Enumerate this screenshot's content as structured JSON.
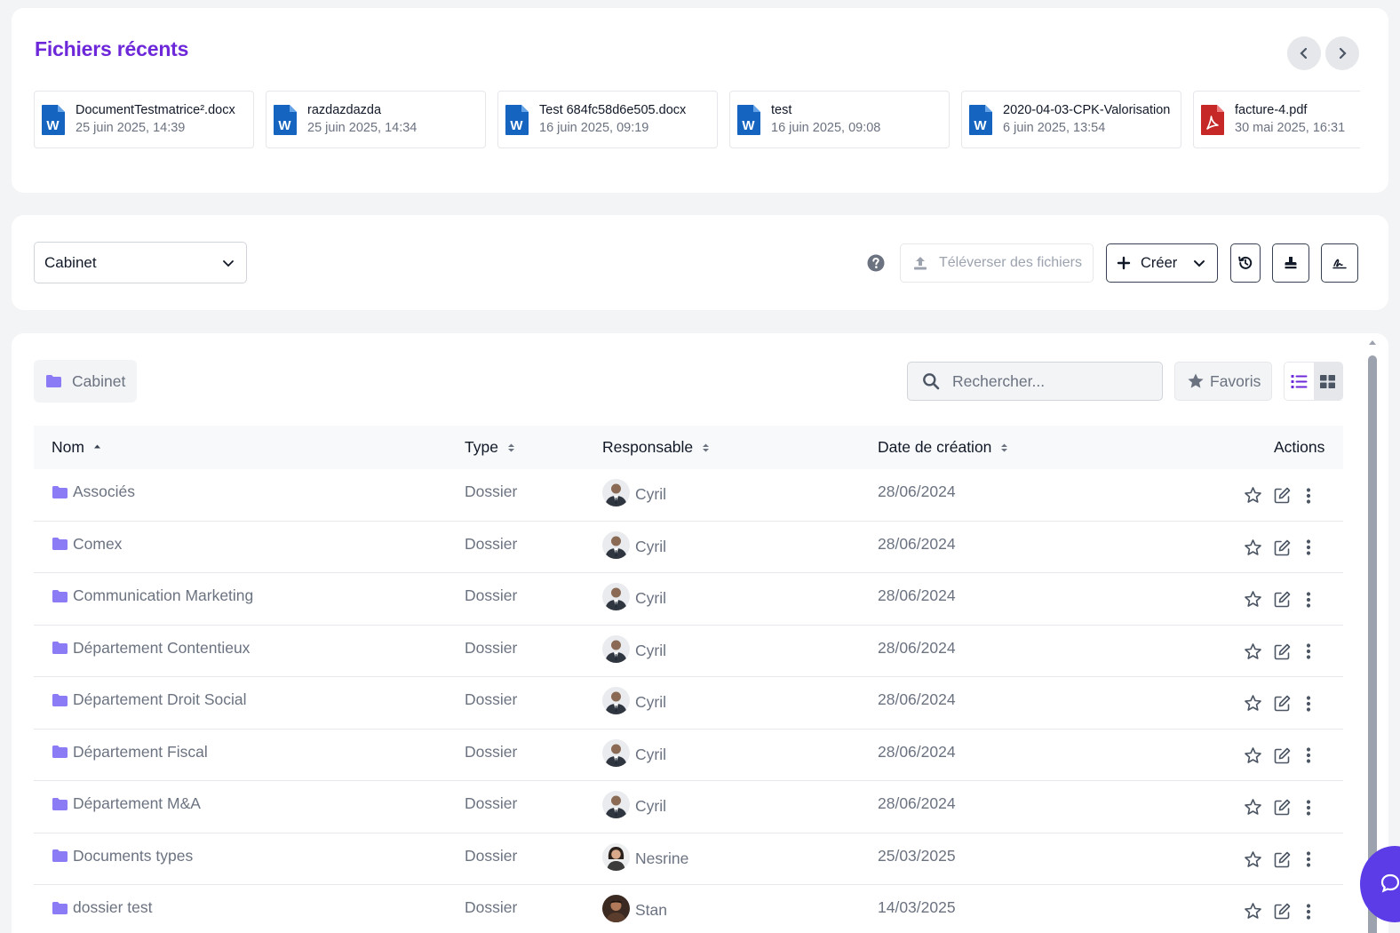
{
  "recent": {
    "title": "Fichiers récents",
    "files": [
      {
        "name": "DocumentTestmatrice².docx",
        "date": "25 juin 2025, 14:39",
        "type": "word"
      },
      {
        "name": "razdazdazda",
        "date": "25 juin 2025, 14:34",
        "type": "word"
      },
      {
        "name": "Test  684fc58d6e505.docx",
        "date": "16 juin 2025, 09:19",
        "type": "word"
      },
      {
        "name": "test",
        "date": "16 juin 2025, 09:08",
        "type": "word"
      },
      {
        "name": "2020-04-03-CPK-Valorisation",
        "date": "6 juin 2025, 13:54",
        "type": "word"
      },
      {
        "name": "facture-4.pdf",
        "date": "30 mai 2025, 16:31",
        "type": "pdf"
      }
    ]
  },
  "toolbar": {
    "space_select": "Cabinet",
    "upload_label": "Téléverser des fichiers",
    "create_label": "Créer"
  },
  "listing": {
    "breadcrumb": "Cabinet",
    "search_placeholder": "Rechercher...",
    "favorites_label": "Favoris",
    "columns": {
      "name": "Nom",
      "type": "Type",
      "owner": "Responsable",
      "created": "Date de création",
      "actions": "Actions"
    },
    "rows": [
      {
        "name": "Associés",
        "type": "Dossier",
        "owner": "Cyril",
        "avatar": "cyril",
        "created": "28/06/2024"
      },
      {
        "name": "Comex",
        "type": "Dossier",
        "owner": "Cyril",
        "avatar": "cyril",
        "created": "28/06/2024"
      },
      {
        "name": "Communication Marketing",
        "type": "Dossier",
        "owner": "Cyril",
        "avatar": "cyril",
        "created": "28/06/2024"
      },
      {
        "name": "Département Contentieux",
        "type": "Dossier",
        "owner": "Cyril",
        "avatar": "cyril",
        "created": "28/06/2024"
      },
      {
        "name": "Département Droit Social",
        "type": "Dossier",
        "owner": "Cyril",
        "avatar": "cyril",
        "created": "28/06/2024"
      },
      {
        "name": "Département Fiscal",
        "type": "Dossier",
        "owner": "Cyril",
        "avatar": "cyril",
        "created": "28/06/2024"
      },
      {
        "name": "Département M&A",
        "type": "Dossier",
        "owner": "Cyril",
        "avatar": "cyril",
        "created": "28/06/2024"
      },
      {
        "name": "Documents types",
        "type": "Dossier",
        "owner": "Nesrine",
        "avatar": "nesrine",
        "created": "25/03/2025"
      },
      {
        "name": "dossier test",
        "type": "Dossier",
        "owner": "Stan",
        "avatar": "stan",
        "created": "14/03/2025"
      }
    ]
  },
  "colors": {
    "accent": "#6d28d9",
    "folder": "#8b7cf6",
    "word": "#1565c0",
    "pdf": "#c62828",
    "chat_fab": "#5b3ce6"
  }
}
